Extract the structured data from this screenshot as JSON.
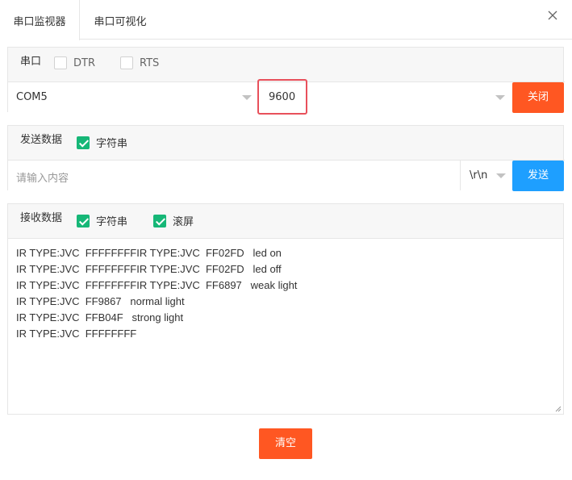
{
  "tabs": [
    {
      "label": "串口监视器",
      "active": true
    },
    {
      "label": "串口可视化",
      "active": false
    }
  ],
  "close_icon": "close-icon",
  "serial": {
    "label": "串口",
    "dtr": {
      "label": "DTR",
      "checked": false
    },
    "rts": {
      "label": "RTS",
      "checked": false
    },
    "port_value": "COM5",
    "baud_value": "9600",
    "close_button": "关闭"
  },
  "send": {
    "label": "发送数据",
    "string_checkbox": {
      "label": "字符串",
      "checked": true
    },
    "input_placeholder": "请输入内容",
    "line_ending": "\\r\\n",
    "send_button": "发送"
  },
  "receive": {
    "label": "接收数据",
    "string_checkbox": {
      "label": "字符串",
      "checked": true
    },
    "autoscroll_checkbox": {
      "label": "滚屏",
      "checked": true
    },
    "lines": [
      "IR TYPE:JVC  FFFFFFFFIR TYPE:JVC  FF02FD   led on",
      "IR TYPE:JVC  FFFFFFFFIR TYPE:JVC  FF02FD   led off",
      "IR TYPE:JVC  FFFFFFFFIR TYPE:JVC  FF6897   weak light",
      "IR TYPE:JVC  FF9867   normal light",
      "IR TYPE:JVC  FFB04F   strong light",
      "IR TYPE:JVC  FFFFFFFF"
    ]
  },
  "clear_button": "清空",
  "colors": {
    "accent_orange": "#ff5722",
    "accent_blue": "#1e9fff",
    "checkbox_green": "#16b777",
    "highlight_red": "#e8505b"
  }
}
